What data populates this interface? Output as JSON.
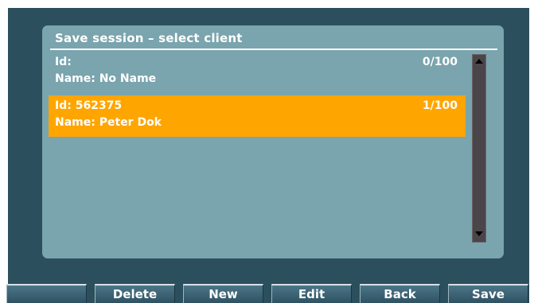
{
  "dialog": {
    "title": "Save session – select client"
  },
  "clients": [
    {
      "id_label": "Id:",
      "name_label": "Name: No Name",
      "count": "0/100",
      "selected": false
    },
    {
      "id_label": "Id: 562375",
      "name_label": "Name: Peter Dok",
      "count": "1/100",
      "selected": true
    }
  ],
  "softkeys": [
    "",
    "Delete",
    "New",
    "Edit",
    "Back",
    "Save"
  ],
  "colors": {
    "screen_bg": "#2c4f5d",
    "dialog_bg": "#7aa4ae",
    "selection": "#ffa500"
  }
}
